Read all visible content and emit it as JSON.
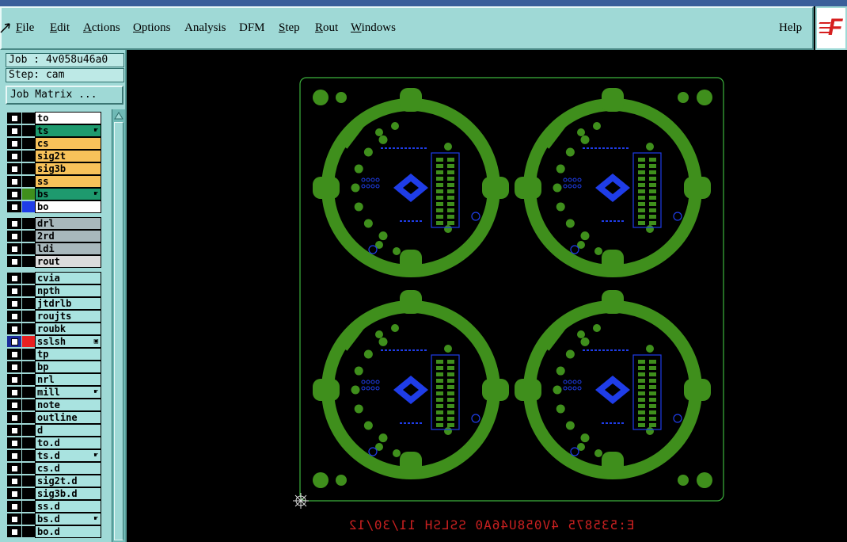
{
  "menubar": {
    "items": [
      {
        "label": "File",
        "accel": "F",
        "rest": "ile"
      },
      {
        "label": "Edit",
        "accel": "E",
        "rest": "dit"
      },
      {
        "label": "Actions",
        "accel": "A",
        "rest": "ctions"
      },
      {
        "label": "Options",
        "accel": "O",
        "rest": "ptions"
      },
      {
        "label": "Analysis",
        "accel": "",
        "rest": "Analysis"
      },
      {
        "label": "DFM",
        "accel": "",
        "rest": "DFM"
      },
      {
        "label": "Step",
        "accel": "S",
        "rest": "tep"
      },
      {
        "label": "Rout",
        "accel": "R",
        "rest": "out"
      },
      {
        "label": "Windows",
        "accel": "W",
        "rest": "indows"
      }
    ],
    "help_label": "Help",
    "logo_text": "F"
  },
  "job": {
    "job_label": "Job : 4v058u46a0",
    "step_label": "Step: cam",
    "matrix_button": "Job Matrix ..."
  },
  "layers": [
    {
      "name": "to",
      "color": "#ffffff",
      "swatch": "",
      "selected": false,
      "marker": ""
    },
    {
      "name": "ts",
      "color": "#1e9a6e",
      "swatch": "",
      "selected": false,
      "marker": "hand"
    },
    {
      "name": "cs",
      "color": "#f8c25a",
      "swatch": "",
      "selected": false,
      "marker": ""
    },
    {
      "name": "sig2t",
      "color": "#f8c25a",
      "swatch": "",
      "selected": false,
      "marker": ""
    },
    {
      "name": "sig3b",
      "color": "#f8c25a",
      "swatch": "",
      "selected": false,
      "marker": ""
    },
    {
      "name": "ss",
      "color": "#f8c25a",
      "swatch": "",
      "selected": false,
      "marker": ""
    },
    {
      "name": "bs",
      "color": "#1e9a6e",
      "swatch": "#3f8f1c",
      "selected": false,
      "marker": "hand"
    },
    {
      "name": "bo",
      "color": "#ffffff",
      "swatch": "#1f3de8",
      "selected": false,
      "marker": ""
    },
    {
      "name": "drl",
      "color": "#a8b8bc",
      "swatch": "",
      "selected": false,
      "marker": ""
    },
    {
      "name": "2rd",
      "color": "#a8b8bc",
      "swatch": "",
      "selected": false,
      "marker": ""
    },
    {
      "name": "ldi",
      "color": "#a8b8bc",
      "swatch": "",
      "selected": false,
      "marker": ""
    },
    {
      "name": "rout",
      "color": "#dcdcdc",
      "swatch": "",
      "selected": false,
      "marker": ""
    },
    {
      "name": "cvia",
      "color": "#a9e3e0",
      "swatch": "",
      "selected": false,
      "marker": ""
    },
    {
      "name": "npth",
      "color": "#a9e3e0",
      "swatch": "",
      "selected": false,
      "marker": ""
    },
    {
      "name": "jtdrlb",
      "color": "#a9e3e0",
      "swatch": "",
      "selected": false,
      "marker": ""
    },
    {
      "name": "roujts",
      "color": "#a9e3e0",
      "swatch": "",
      "selected": false,
      "marker": ""
    },
    {
      "name": "roubk",
      "color": "#a9e3e0",
      "swatch": "",
      "selected": false,
      "marker": ""
    },
    {
      "name": "sslsh",
      "color": "#a9e3e0",
      "swatch": "#e82020",
      "selected": true,
      "marker": "box"
    },
    {
      "name": "tp",
      "color": "#a9e3e0",
      "swatch": "",
      "selected": false,
      "marker": ""
    },
    {
      "name": "bp",
      "color": "#a9e3e0",
      "swatch": "",
      "selected": false,
      "marker": ""
    },
    {
      "name": "nrl",
      "color": "#a9e3e0",
      "swatch": "",
      "selected": false,
      "marker": ""
    },
    {
      "name": "mill",
      "color": "#a9e3e0",
      "swatch": "",
      "selected": false,
      "marker": "hand"
    },
    {
      "name": "note",
      "color": "#a9e3e0",
      "swatch": "",
      "selected": false,
      "marker": ""
    },
    {
      "name": "outline",
      "color": "#a9e3e0",
      "swatch": "",
      "selected": false,
      "marker": ""
    },
    {
      "name": "d",
      "color": "#a9e3e0",
      "swatch": "",
      "selected": false,
      "marker": ""
    },
    {
      "name": "to.d",
      "color": "#a9e3e0",
      "swatch": "",
      "selected": false,
      "marker": ""
    },
    {
      "name": "ts.d",
      "color": "#a9e3e0",
      "swatch": "",
      "selected": false,
      "marker": "hand"
    },
    {
      "name": "cs.d",
      "color": "#a9e3e0",
      "swatch": "",
      "selected": false,
      "marker": ""
    },
    {
      "name": "sig2t.d",
      "color": "#a9e3e0",
      "swatch": "",
      "selected": false,
      "marker": ""
    },
    {
      "name": "sig3b.d",
      "color": "#a9e3e0",
      "swatch": "",
      "selected": false,
      "marker": ""
    },
    {
      "name": "ss.d",
      "color": "#a9e3e0",
      "swatch": "",
      "selected": false,
      "marker": ""
    },
    {
      "name": "bs.d",
      "color": "#a9e3e0",
      "swatch": "",
      "selected": false,
      "marker": "hand"
    },
    {
      "name": "bo.d",
      "color": "#a9e3e0",
      "swatch": "",
      "selected": false,
      "marker": ""
    }
  ],
  "canvas": {
    "board_outline_color": "#3cb33c",
    "copper_color": "#3f8f1c",
    "silk_color": "#1f3de8",
    "date_code": "E:535875 4V058U46A0 SSLSH 11/30/12",
    "date_code_color": "#c82020",
    "panels": 4
  }
}
